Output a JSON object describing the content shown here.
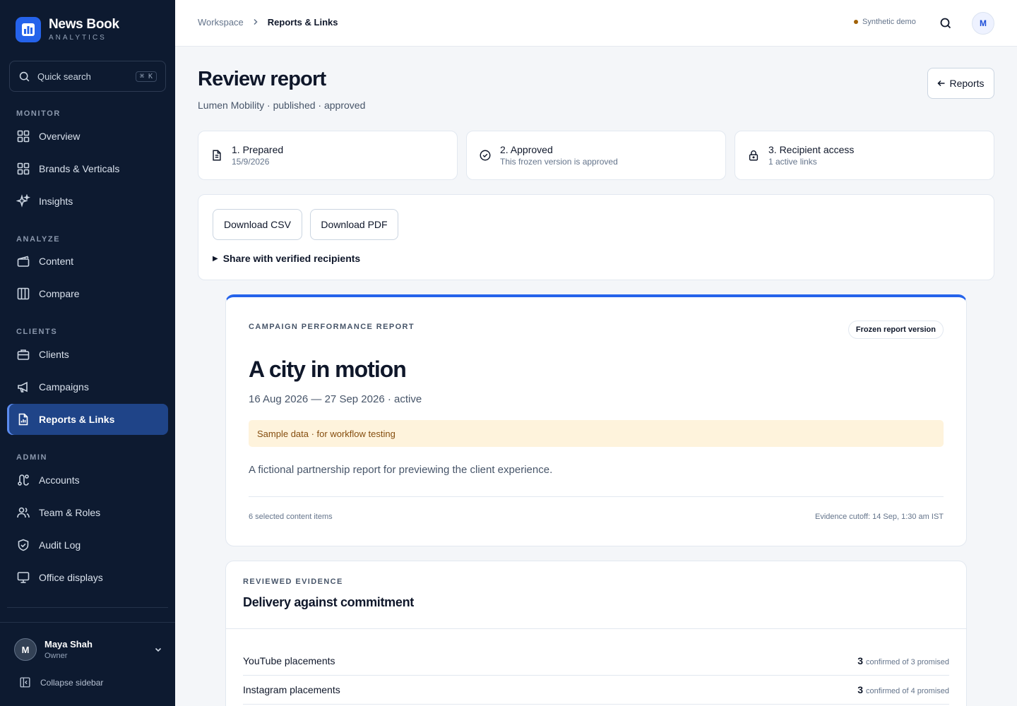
{
  "brand": {
    "name": "News Book",
    "subtitle": "ANALYTICS"
  },
  "search": {
    "label": "Quick search",
    "shortcut": "⌘ K"
  },
  "sidebar": {
    "sections": {
      "monitor": "MONITOR",
      "analyze": "ANALYZE",
      "clients": "CLIENTS",
      "admin": "ADMIN"
    },
    "items": {
      "overview": "Overview",
      "brands": "Brands & Verticals",
      "insights": "Insights",
      "content": "Content",
      "compare": "Compare",
      "clients": "Clients",
      "campaigns": "Campaigns",
      "reports": "Reports & Links",
      "accounts": "Accounts",
      "team": "Team & Roles",
      "audit": "Audit Log",
      "displays": "Office displays"
    },
    "active_item": "reports"
  },
  "user": {
    "initial": "M",
    "name": "Maya Shah",
    "role": "Owner"
  },
  "collapse_label": "Collapse sidebar",
  "topbar": {
    "breadcrumb_root": "Workspace",
    "breadcrumb_current": "Reports & Links",
    "demo_label": "Synthetic demo",
    "avatar_initial": "M"
  },
  "page": {
    "title": "Review report",
    "subtitle": "Lumen Mobility · published · approved",
    "back_label": "Reports"
  },
  "steps": [
    {
      "title": "1. Prepared",
      "sub": "15/9/2026"
    },
    {
      "title": "2. Approved",
      "sub": "This frozen version is approved"
    },
    {
      "title": "3. Recipient access",
      "sub": "1 active links"
    }
  ],
  "actions": {
    "csv": "Download CSV",
    "pdf": "Download PDF",
    "share": "Share with verified recipients"
  },
  "report": {
    "eyebrow": "CAMPAIGN PERFORMANCE REPORT",
    "badge": "Frozen report version",
    "title": "A city in motion",
    "dates": "16 Aug 2026 — 27 Sep 2026 · active",
    "notice": "Sample data · for workflow testing",
    "description": "A fictional partnership report for previewing the client experience.",
    "items_count": "6 selected content items",
    "cutoff": "Evidence cutoff: 14 Sep, 1:30 am IST"
  },
  "evidence": {
    "eyebrow": "REVIEWED EVIDENCE",
    "title": "Delivery against commitment",
    "rows": [
      {
        "label": "YouTube placements",
        "confirmed": "3",
        "detail": "confirmed of 3 promised"
      },
      {
        "label": "Instagram placements",
        "confirmed": "3",
        "detail": "confirmed of 4 promised"
      }
    ]
  },
  "colors": {
    "sidebar_bg": "#0d1a30",
    "accent": "#2563eb",
    "active_nav": "#1f4488",
    "notice_bg": "#fef3dc"
  }
}
